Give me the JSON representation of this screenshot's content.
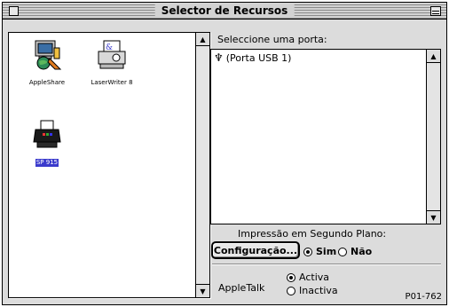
{
  "window": {
    "title": "Selector de Recursos"
  },
  "devices": {
    "items": [
      {
        "label": "AppleShare",
        "icon": "appleshare-icon",
        "selected": false
      },
      {
        "label": "LaserWriter 8",
        "icon": "laserwriter-icon",
        "selected": false
      },
      {
        "label": "SP 915",
        "icon": "inkjet-printer-icon",
        "selected": true
      }
    ]
  },
  "ports": {
    "caption": "Seleccione uma porta:",
    "items": [
      {
        "label": "(Porta USB 1)",
        "icon": "usb-icon",
        "icon_glyph": "♆"
      }
    ]
  },
  "background_printing": {
    "caption": "Impressão em Segundo Plano:",
    "config_button": "Configuração...",
    "options": [
      {
        "label": "Sim",
        "checked": true
      },
      {
        "label": "Não",
        "checked": false
      }
    ]
  },
  "appletalk": {
    "label": "AppleTalk",
    "options": [
      {
        "label": "Activa",
        "checked": true
      },
      {
        "label": "Inactiva",
        "checked": false
      }
    ]
  },
  "footer": {
    "code": "P01-762"
  },
  "colors": {
    "selection": "#3a3acc",
    "window_bg": "#dcdcdc"
  }
}
